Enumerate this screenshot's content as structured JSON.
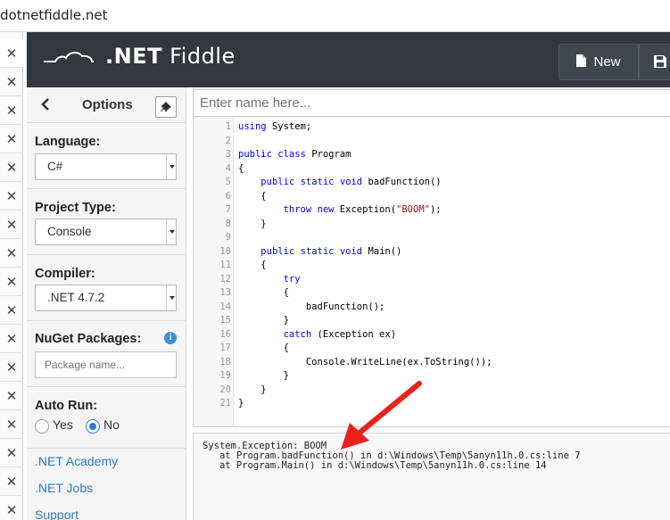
{
  "browser": {
    "url": "dotnetfiddle.net"
  },
  "tabs": {
    "count": 17,
    "close_glyph": "✕"
  },
  "header": {
    "brand_prefix": ".NET",
    "brand_name": "Fiddle",
    "new_button": "New",
    "bg_color": "#33383f"
  },
  "options": {
    "title": "Options",
    "language_label": "Language:",
    "language_value": "C#",
    "project_type_label": "Project Type:",
    "project_type_value": "Console",
    "compiler_label": "Compiler:",
    "compiler_value": ".NET 4.7.2",
    "nuget_label": "NuGet Packages:",
    "nuget_placeholder": "Package name...",
    "autorun_label": "Auto Run:",
    "autorun_yes": "Yes",
    "autorun_no": "No",
    "autorun_selected": "No",
    "links": [
      ".NET Academy",
      ".NET Jobs",
      "Support"
    ]
  },
  "editor": {
    "name_placeholder": "Enter name here...",
    "lines": [
      {
        "n": "1",
        "html": "<span class=\"kw\">using</span> System;"
      },
      {
        "n": "2",
        "html": ""
      },
      {
        "n": "3",
        "html": "<span class=\"kw\">public</span> <span class=\"kw\">class</span> Program"
      },
      {
        "n": "4",
        "html": "{"
      },
      {
        "n": "5",
        "html": "    <span class=\"kw\">public</span> <span class=\"kw\">static</span> <span class=\"kw\">void</span> badFunction()"
      },
      {
        "n": "6",
        "html": "    {"
      },
      {
        "n": "7",
        "html": "        <span class=\"kw\">throw</span> <span class=\"kw\">new</span> Exception(<span class=\"str\">\"BOOM\"</span>);"
      },
      {
        "n": "8",
        "html": "    }"
      },
      {
        "n": "9",
        "html": ""
      },
      {
        "n": "10",
        "html": "    <span class=\"kw\">public</span> <span class=\"kw\">static</span> <span class=\"kw\">void</span> Main()"
      },
      {
        "n": "11",
        "html": "    {"
      },
      {
        "n": "12",
        "html": "        <span class=\"kw\">try</span>"
      },
      {
        "n": "13",
        "html": "        {"
      },
      {
        "n": "14",
        "html": "            badFunction();"
      },
      {
        "n": "15",
        "html": "        }"
      },
      {
        "n": "16",
        "html": "        <span class=\"kw\">catch</span> (Exception ex)"
      },
      {
        "n": "17",
        "html": "        {"
      },
      {
        "n": "18",
        "html": "            Console.WriteLine(ex.ToString());"
      },
      {
        "n": "19",
        "html": "        }"
      },
      {
        "n": "20",
        "html": "    }"
      },
      {
        "n": "21",
        "html": "}"
      }
    ]
  },
  "output": {
    "lines": [
      "System.Exception: BOOM",
      "   at Program.badFunction() in d:\\Windows\\Temp\\5anyn11h.0.cs:line 7",
      "   at Program.Main() in d:\\Windows\\Temp\\5anyn11h.0.cs:line 14"
    ]
  },
  "annotation": {
    "arrow_color": "#e8221b"
  }
}
